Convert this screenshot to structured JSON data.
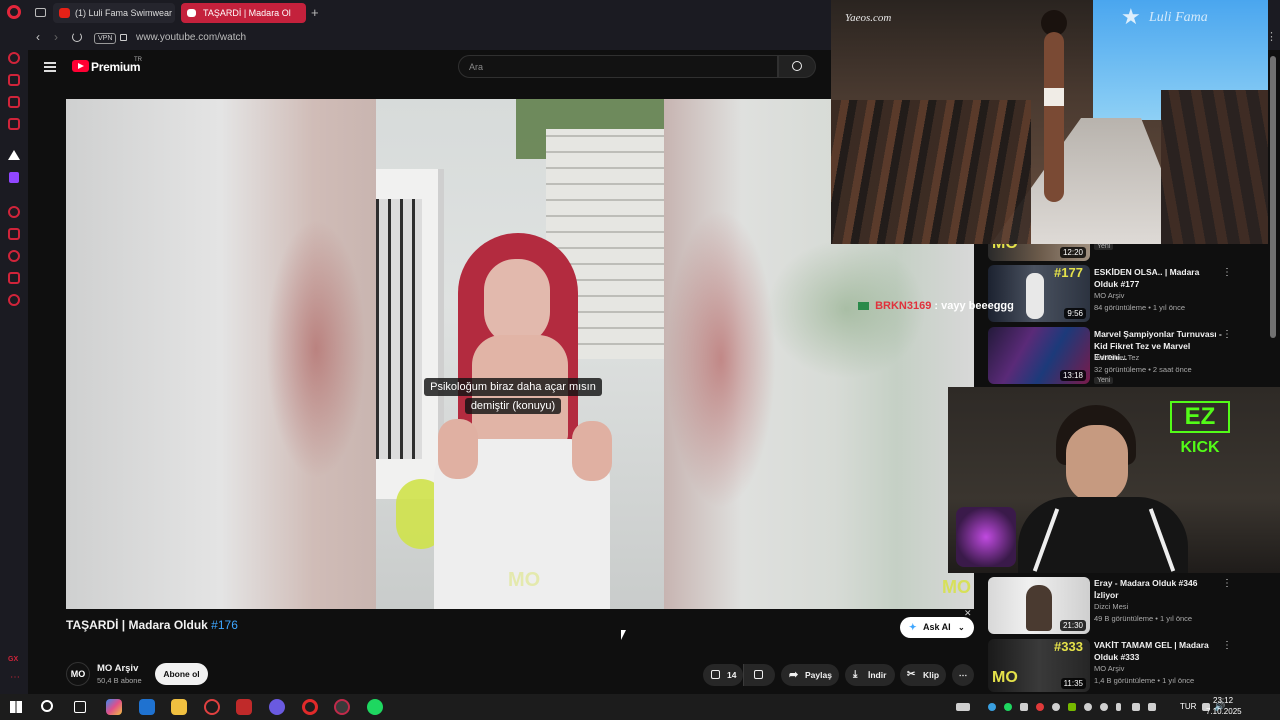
{
  "browser": {
    "tabs": [
      {
        "title": "(1) Luli Fama Swimwear F"
      },
      {
        "title": "TAŞARDİ | Madara Ol"
      }
    ],
    "vpn_badge": "VPN",
    "url": "www.youtube.com/watch"
  },
  "youtube": {
    "logo_text": "Premium",
    "logo_sup": "TR",
    "search_placeholder": "Ara"
  },
  "video": {
    "caption_line1": "Psikoloğum biraz daha açar mısın",
    "caption_line2": "demiştir (konuyu)",
    "watermark": "MO",
    "title_main": "TAŞARDİ | Madara Olduk",
    "title_hashtag": "#176",
    "channel_name": "MO Arşiv",
    "channel_subs": "50,4 B abone",
    "subscribe_label": "Abone ol",
    "like_count": "14",
    "share_label": "Paylaş",
    "download_label": "İndir",
    "clip_label": "Klip",
    "ask_ai_label": "Ask AI"
  },
  "chat": {
    "username": "BRKN3169",
    "message": ": vayy beeeggg"
  },
  "overlay": {
    "brand_left": "Yaeos.com",
    "brand_right": "Luli Fama",
    "kick_badge_top": "EZ",
    "kick_badge_bottom": "KICK"
  },
  "recommendations": [
    {
      "thumb_text": "MO",
      "duration": "12:20",
      "badge": "Yeni"
    },
    {
      "thumb_text": "#177",
      "duration": "9:56",
      "title": "ESKİDEN OLSA.. | Madara Olduk #177",
      "channel": "MO Arşiv",
      "meta": "84 görüntüleme • 1 yıl önce"
    },
    {
      "duration": "13:18",
      "title": "Marvel Şampiyonlar Turnuvası - Kid Fikret Tez ve Marvel Evreni...",
      "channel": "Kid Fikret Tez",
      "meta": "32 görüntüleme • 2 saat önce",
      "badge": "Yeni"
    },
    {
      "duration": "21:30",
      "title": "Eray - Madara Olduk #346 İzliyor",
      "channel": "Dizci Mesi",
      "meta": "49 B görüntüleme • 1 yıl önce"
    },
    {
      "thumb_text": "#333",
      "thumb_text2": "MO",
      "duration": "11:35",
      "title": "VAKİT TAMAM GEL | Madara Olduk #333",
      "channel": "MO Arşiv",
      "meta": "1,4 B görüntüleme • 1 yıl önce"
    }
  ],
  "taskbar": {
    "language": "TUR",
    "time": "23:12",
    "date": "7.10.2025"
  },
  "colors": {
    "accent_red": "#ff0033",
    "opera_red": "#d0243a",
    "kick_green": "#53fc18",
    "hashtag_blue": "#3ea6ff"
  }
}
